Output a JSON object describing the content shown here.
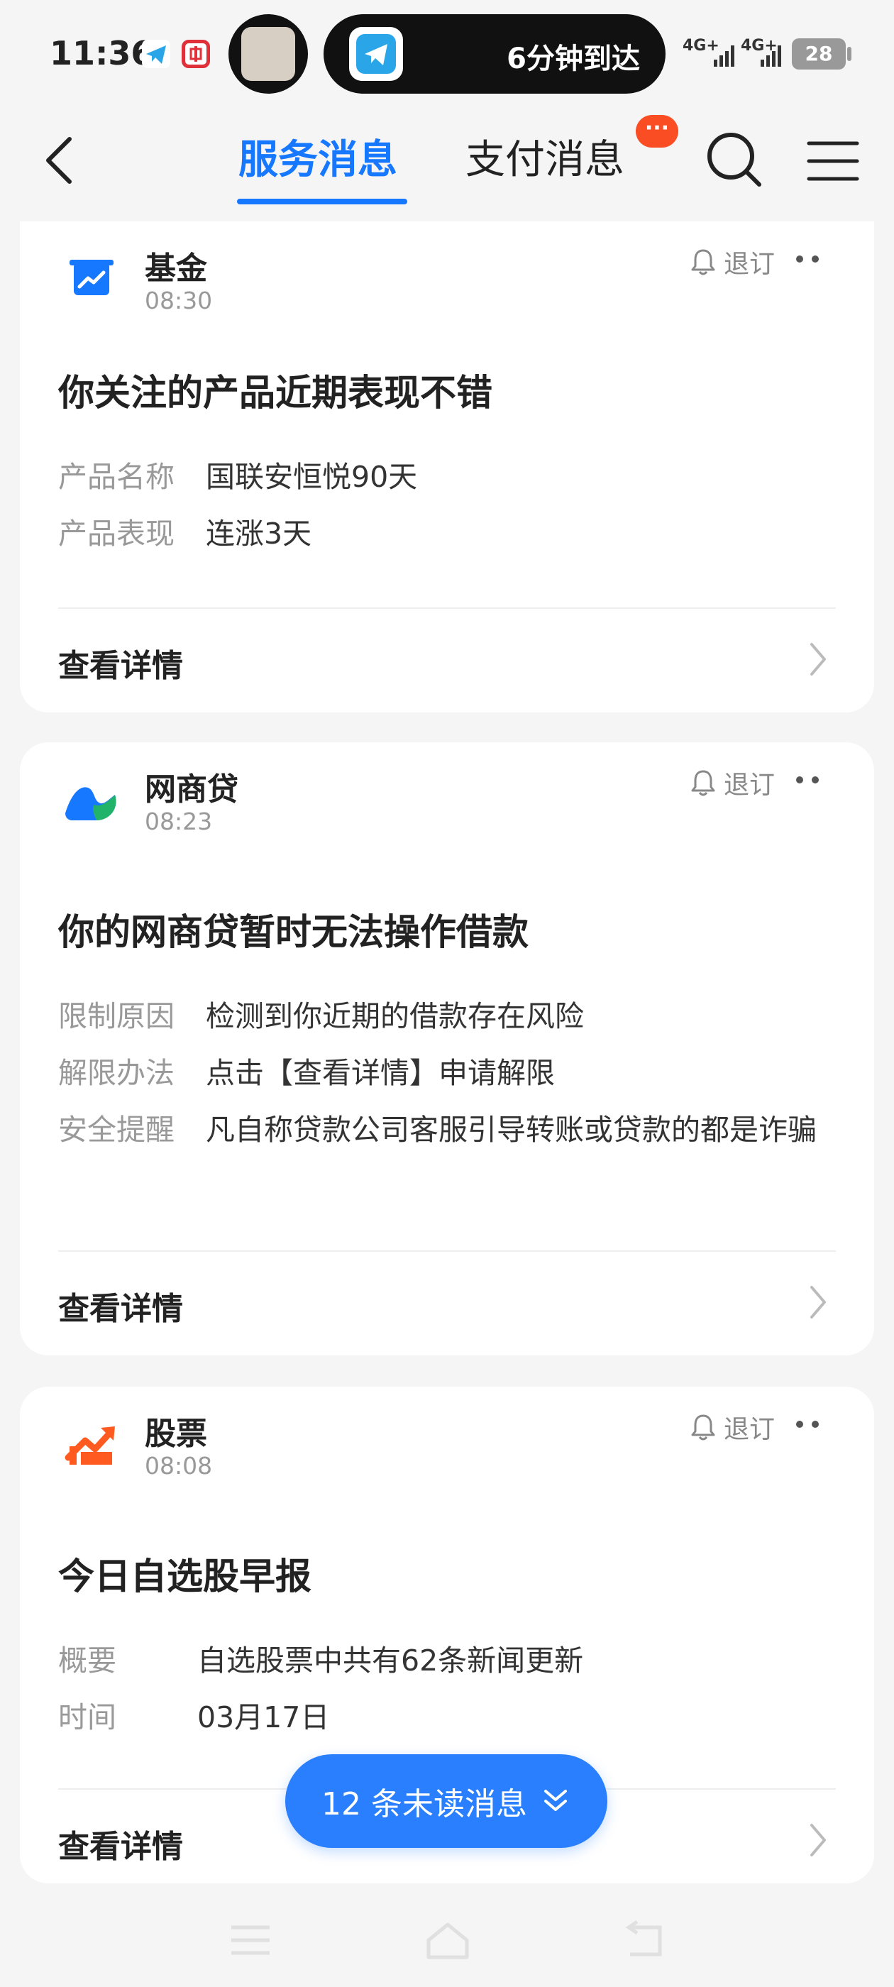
{
  "status_bar": {
    "time": "11:36",
    "island_text": "6分钟到达",
    "network_1": "4G+",
    "network_2": "4G+",
    "battery": "28"
  },
  "header": {
    "tabs": [
      {
        "label": "服务消息",
        "active": true
      },
      {
        "label": "支付消息",
        "active": false
      }
    ],
    "badge": "···",
    "accent_color": "#1677ff",
    "badge_color": "#fa4d24"
  },
  "cards": [
    {
      "name": "基金",
      "time": "08:30",
      "unsubscribe_label": "退订",
      "title": "你关注的产品近期表现不错",
      "rows": [
        {
          "label": "产品名称",
          "value": "国联安恒悦90天"
        },
        {
          "label": "产品表现",
          "value": "连涨3天"
        }
      ],
      "detail_label": "查看详情",
      "logo_icon": "fund-chart-icon",
      "logo_color": "#1677ff"
    },
    {
      "name": "网商贷",
      "time": "08:23",
      "unsubscribe_label": "退订",
      "title": "你的网商贷暂时无法操作借款",
      "rows": [
        {
          "label": "限制原因",
          "value": "检测到你近期的借款存在风险"
        },
        {
          "label": "解限办法",
          "value": "点击【查看详情】申请解限"
        },
        {
          "label": "安全提醒",
          "value": "凡自称贷款公司客服引导转账或贷款的都是诈骗"
        }
      ],
      "detail_label": "查看详情",
      "logo_icon": "mybank-loan-icon",
      "logo_color": "#1677ff"
    },
    {
      "name": "股票",
      "time": "08:08",
      "unsubscribe_label": "退订",
      "title": "今日自选股早报",
      "rows": [
        {
          "label": "概要",
          "value": "自选股票中共有62条新闻更新"
        },
        {
          "label": "时间",
          "value": "03月17日"
        }
      ],
      "detail_label": "查看详情",
      "logo_icon": "stock-trend-icon",
      "logo_color": "#ff5a1f"
    }
  ],
  "unread": {
    "label": "12 条未读消息"
  }
}
